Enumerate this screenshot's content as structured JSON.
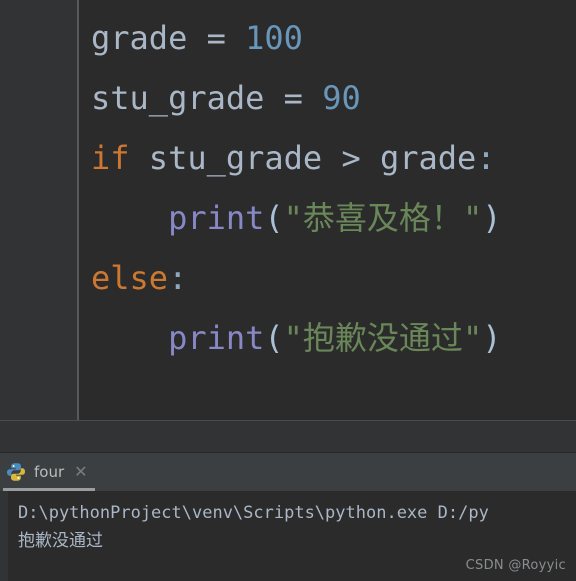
{
  "theme": {
    "editor_bg": "#2b2b2b",
    "gutter_bg": "#313335",
    "panel_bg": "#3c3f41",
    "console_bg": "#2b2b2b",
    "keyword_color": "#cc7832",
    "number_color": "#6897bb",
    "string_color": "#6a8759",
    "function_color": "#8888c6",
    "default_text_color": "#a9b7c6",
    "warning_squiggle_color": "#bbb529"
  },
  "editor": {
    "language": "python",
    "lines": [
      {
        "indent": 0,
        "tokens": [
          {
            "text": "grade",
            "type": "var"
          },
          {
            "text": " ",
            "type": "plain"
          },
          {
            "text": "=",
            "type": "op"
          },
          {
            "text": " ",
            "type": "plain"
          },
          {
            "text": "100",
            "type": "num"
          }
        ]
      },
      {
        "indent": 0,
        "tokens": [
          {
            "text": "stu_grade",
            "type": "var"
          },
          {
            "text": " ",
            "type": "plain"
          },
          {
            "text": "=",
            "type": "op"
          },
          {
            "text": " ",
            "type": "plain"
          },
          {
            "text": "90",
            "type": "num"
          }
        ]
      },
      {
        "indent": 0,
        "tokens": [
          {
            "text": "if",
            "type": "kw"
          },
          {
            "text": " ",
            "type": "plain"
          },
          {
            "text": "stu_grade",
            "type": "var"
          },
          {
            "text": " ",
            "type": "plain"
          },
          {
            "text": ">",
            "type": "op"
          },
          {
            "text": " ",
            "type": "plain"
          },
          {
            "text": "grade",
            "type": "var"
          },
          {
            "text": ":",
            "type": "colon"
          }
        ]
      },
      {
        "indent": 4,
        "tokens": [
          {
            "text": "print",
            "type": "fn"
          },
          {
            "text": "(",
            "type": "paren"
          },
          {
            "text": "\"",
            "type": "str"
          },
          {
            "text": "恭喜及格！",
            "type": "cjk"
          },
          {
            "text": "\"",
            "type": "str"
          },
          {
            "text": ")",
            "type": "paren"
          }
        ]
      },
      {
        "indent": 0,
        "tokens": [
          {
            "text": "else",
            "type": "kw"
          },
          {
            "text": ":",
            "type": "colon"
          }
        ]
      },
      {
        "indent": 4,
        "tokens": [
          {
            "text": "print",
            "type": "fn"
          },
          {
            "text": "(",
            "type": "paren"
          },
          {
            "text": "\"",
            "type": "str"
          },
          {
            "text": "抱歉没通过",
            "type": "cjk"
          },
          {
            "text": "\"",
            "type": "str"
          },
          {
            "text": ")",
            "type": "paren"
          }
        ]
      }
    ],
    "plain_code": "grade = 100\nstu_grade = 90\nif stu_grade > grade:\n    print(\"恭喜及格！\")\nelse:\n    print(\"抱歉没通过\")",
    "inspection_warning_present": true
  },
  "run_panel": {
    "tab": {
      "icon": "python-file-icon",
      "label": "four",
      "close_label": "✕"
    },
    "console_output": [
      "D:\\pythonProject\\venv\\Scripts\\python.exe D:/py",
      "抱歉没通过"
    ]
  },
  "watermark": {
    "text": "CSDN @Royyic"
  }
}
